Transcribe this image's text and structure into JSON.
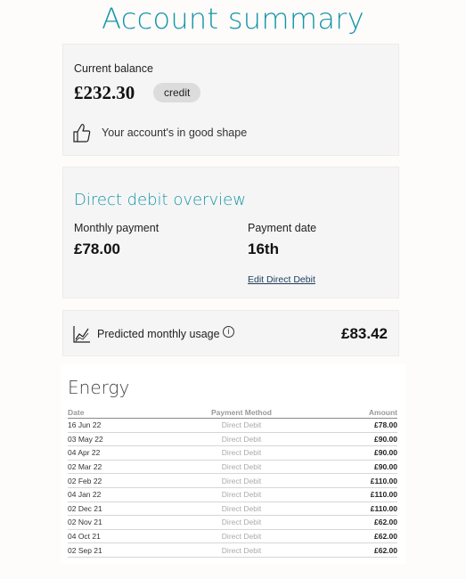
{
  "page": {
    "title": "Account summary"
  },
  "balance": {
    "label": "Current balance",
    "value": "£232.30",
    "badge": "credit",
    "health_text": "Your account's in good shape",
    "health_icon": "thumbs-up-icon"
  },
  "direct_debit": {
    "title": "Direct debit overview",
    "monthly_payment_label": "Monthly payment",
    "monthly_payment_value": "£78.00",
    "payment_date_label": "Payment date",
    "payment_date_value": "16th",
    "edit_link": "Edit Direct Debit"
  },
  "usage": {
    "label": "Predicted monthly usage",
    "info_icon_glyph": "i",
    "value": "£83.42",
    "icon": "line-chart-icon"
  },
  "energy": {
    "title": "Energy",
    "columns": [
      "Date",
      "Payment Method",
      "Amount"
    ],
    "rows": [
      [
        "16 Jun 22",
        "Direct Debit",
        "£78.00"
      ],
      [
        "03 May 22",
        "Direct Debit",
        "£90.00"
      ],
      [
        "04 Apr 22",
        "Direct Debit",
        "£90.00"
      ],
      [
        "02 Mar 22",
        "Direct Debit",
        "£90.00"
      ],
      [
        "02 Feb 22",
        "Direct Debit",
        "£110.00"
      ],
      [
        "04 Jan 22",
        "Direct Debit",
        "£110.00"
      ],
      [
        "02 Dec 21",
        "Direct Debit",
        "£110.00"
      ],
      [
        "02 Nov 21",
        "Direct Debit",
        "£62.00"
      ],
      [
        "04 Oct 21",
        "Direct Debit",
        "£62.00"
      ],
      [
        "02 Sep 21",
        "Direct Debit",
        "£62.00"
      ]
    ]
  },
  "colors": {
    "accent": "#1596a8",
    "card_bg": "#f5f5f5",
    "link": "#1c3d5c"
  }
}
